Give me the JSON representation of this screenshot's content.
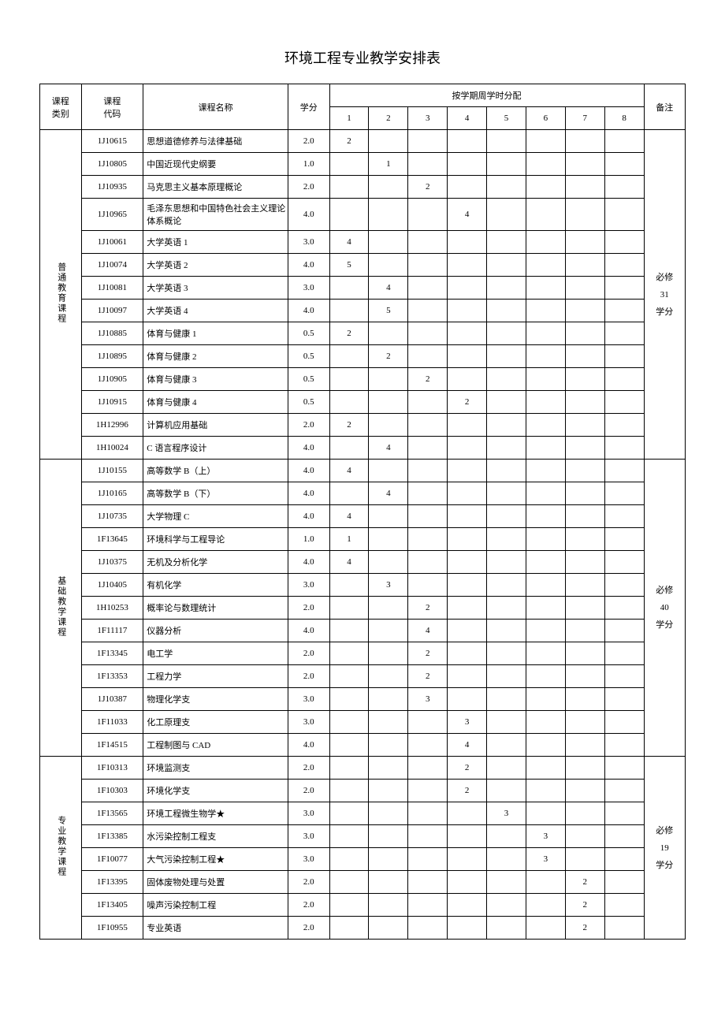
{
  "title": "环境工程专业教学安排表",
  "headers": {
    "category": "课程\n类别",
    "code": "课程\n代码",
    "name": "课程名称",
    "credit": "学分",
    "distribution": "按学期周学时分配",
    "semesters": [
      "1",
      "2",
      "3",
      "4",
      "5",
      "6",
      "7",
      "8"
    ],
    "note": "备注"
  },
  "groups": [
    {
      "category": "普通教育课程",
      "note": "必修\n31\n学分",
      "rows": [
        {
          "code": "1J10615",
          "name": "思想道德修养与法律基础",
          "credit": "2.0",
          "s": [
            "2",
            "",
            "",
            "",
            "",
            "",
            "",
            ""
          ]
        },
        {
          "code": "1J10805",
          "name": "中国近现代史纲要",
          "credit": "1.0",
          "s": [
            "",
            "1",
            "",
            "",
            "",
            "",
            "",
            ""
          ]
        },
        {
          "code": "1J10935",
          "name": "马克思主义基本原理概论",
          "credit": "2.0",
          "s": [
            "",
            "",
            "2",
            "",
            "",
            "",
            "",
            ""
          ]
        },
        {
          "code": "1J10965",
          "name": "毛泽东思想和中国特色社会主义理论体系概论",
          "credit": "4.0",
          "s": [
            "",
            "",
            "",
            "4",
            "",
            "",
            "",
            ""
          ]
        },
        {
          "code": "1J10061",
          "name": "大学英语 1",
          "credit": "3.0",
          "s": [
            "4",
            "",
            "",
            "",
            "",
            "",
            "",
            ""
          ]
        },
        {
          "code": "1J10074",
          "name": "大学英语 2",
          "credit": "4.0",
          "s": [
            "5",
            "",
            "",
            "",
            "",
            "",
            "",
            ""
          ]
        },
        {
          "code": "1J10081",
          "name": "大学英语 3",
          "credit": "3.0",
          "s": [
            "",
            "4",
            "",
            "",
            "",
            "",
            "",
            ""
          ]
        },
        {
          "code": "1J10097",
          "name": "大学英语 4",
          "credit": "4.0",
          "s": [
            "",
            "5",
            "",
            "",
            "",
            "",
            "",
            ""
          ]
        },
        {
          "code": "1J10885",
          "name": "体育与健康 1",
          "credit": "0.5",
          "s": [
            "2",
            "",
            "",
            "",
            "",
            "",
            "",
            ""
          ]
        },
        {
          "code": "1J10895",
          "name": "体育与健康 2",
          "credit": "0.5",
          "s": [
            "",
            "2",
            "",
            "",
            "",
            "",
            "",
            ""
          ]
        },
        {
          "code": "1J10905",
          "name": "体育与健康 3",
          "credit": "0.5",
          "s": [
            "",
            "",
            "2",
            "",
            "",
            "",
            "",
            ""
          ]
        },
        {
          "code": "1J10915",
          "name": "体育与健康 4",
          "credit": "0.5",
          "s": [
            "",
            "",
            "",
            "2",
            "",
            "",
            "",
            ""
          ]
        },
        {
          "code": "1H12996",
          "name": "计算机应用基础",
          "credit": "2.0",
          "s": [
            "2",
            "",
            "",
            "",
            "",
            "",
            "",
            ""
          ]
        },
        {
          "code": "1H10024",
          "name": "C 语言程序设计",
          "credit": "4.0",
          "s": [
            "",
            "4",
            "",
            "",
            "",
            "",
            "",
            ""
          ]
        }
      ]
    },
    {
      "category": "基础教学课程",
      "note": "必修\n40\n学分",
      "rows": [
        {
          "code": "1J10155",
          "name": "高等数学 B（上）",
          "credit": "4.0",
          "s": [
            "4",
            "",
            "",
            "",
            "",
            "",
            "",
            ""
          ]
        },
        {
          "code": "1J10165",
          "name": "高等数学 B（下）",
          "credit": "4.0",
          "s": [
            "",
            "4",
            "",
            "",
            "",
            "",
            "",
            ""
          ]
        },
        {
          "code": "1J10735",
          "name": "大学物理 C",
          "credit": "4.0",
          "s": [
            "4",
            "",
            "",
            "",
            "",
            "",
            "",
            ""
          ]
        },
        {
          "code": "1F13645",
          "name": "环境科学与工程导论",
          "credit": "1.0",
          "s": [
            "1",
            "",
            "",
            "",
            "",
            "",
            "",
            ""
          ]
        },
        {
          "code": "1J10375",
          "name": "无机及分析化学",
          "credit": "4.0",
          "s": [
            "4",
            "",
            "",
            "",
            "",
            "",
            "",
            ""
          ]
        },
        {
          "code": "1J10405",
          "name": "有机化学",
          "credit": "3.0",
          "s": [
            "",
            "3",
            "",
            "",
            "",
            "",
            "",
            ""
          ]
        },
        {
          "code": "1H10253",
          "name": "概率论与数理统计",
          "credit": "2.0",
          "s": [
            "",
            "",
            "2",
            "",
            "",
            "",
            "",
            ""
          ]
        },
        {
          "code": "1F11117",
          "name": "仪器分析",
          "credit": "4.0",
          "s": [
            "",
            "",
            "4",
            "",
            "",
            "",
            "",
            ""
          ]
        },
        {
          "code": "1F13345",
          "name": "电工学",
          "credit": "2.0",
          "s": [
            "",
            "",
            "2",
            "",
            "",
            "",
            "",
            ""
          ]
        },
        {
          "code": "1F13353",
          "name": "工程力学",
          "credit": "2.0",
          "s": [
            "",
            "",
            "2",
            "",
            "",
            "",
            "",
            ""
          ]
        },
        {
          "code": "1J10387",
          "name": "物理化学支",
          "credit": "3.0",
          "s": [
            "",
            "",
            "3",
            "",
            "",
            "",
            "",
            ""
          ]
        },
        {
          "code": "1F11033",
          "name": "化工原理支",
          "credit": "3.0",
          "s": [
            "",
            "",
            "",
            "3",
            "",
            "",
            "",
            ""
          ]
        },
        {
          "code": "1F14515",
          "name": "工程制图与 CAD",
          "credit": "4.0",
          "s": [
            "",
            "",
            "",
            "4",
            "",
            "",
            "",
            ""
          ]
        }
      ]
    },
    {
      "category": "专业教学课程",
      "note": "必修\n19\n学分",
      "rows": [
        {
          "code": "1F10313",
          "name": "环境监测支",
          "credit": "2.0",
          "s": [
            "",
            "",
            "",
            "2",
            "",
            "",
            "",
            ""
          ]
        },
        {
          "code": "1F10303",
          "name": "环境化学支",
          "credit": "2.0",
          "s": [
            "",
            "",
            "",
            "2",
            "",
            "",
            "",
            ""
          ]
        },
        {
          "code": "1F13565",
          "name": "环境工程微生物学★",
          "credit": "3.0",
          "s": [
            "",
            "",
            "",
            "",
            "3",
            "",
            "",
            ""
          ]
        },
        {
          "code": "1F13385",
          "name": "水污染控制工程支",
          "credit": "3.0",
          "s": [
            "",
            "",
            "",
            "",
            "",
            "3",
            "",
            ""
          ]
        },
        {
          "code": "1F10077",
          "name": "大气污染控制工程★",
          "credit": "3.0",
          "s": [
            "",
            "",
            "",
            "",
            "",
            "3",
            "",
            ""
          ]
        },
        {
          "code": "1F13395",
          "name": "固体废物处理与处置",
          "credit": "2.0",
          "s": [
            "",
            "",
            "",
            "",
            "",
            "",
            "2",
            ""
          ]
        },
        {
          "code": "1F13405",
          "name": "噪声污染控制工程",
          "credit": "2.0",
          "s": [
            "",
            "",
            "",
            "",
            "",
            "",
            "2",
            ""
          ]
        },
        {
          "code": "1F10955",
          "name": "专业英语",
          "credit": "2.0",
          "s": [
            "",
            "",
            "",
            "",
            "",
            "",
            "2",
            ""
          ]
        }
      ]
    }
  ]
}
